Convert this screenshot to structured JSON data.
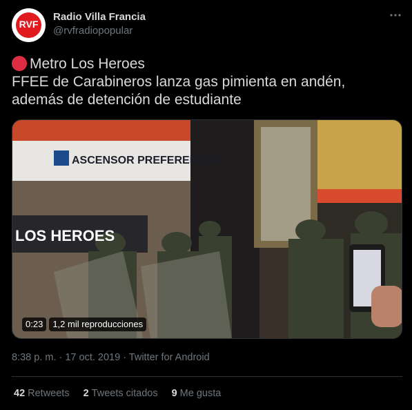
{
  "account": {
    "name": "Radio Villa Francia",
    "handle": "@rvfradiopopular",
    "avatar_text": "RVF",
    "more_icon": "ellipsis-icon"
  },
  "tweet": {
    "emoji": "red-circle",
    "line1": "Metro Los Heroes",
    "line2": "FFEE  de Carabineros  lanza  gas pimienta en andén,",
    "line3": "además de detención de estudiante"
  },
  "media": {
    "sign_main": "ASCENSOR PREFERENCIAL",
    "sign_station": "LOS HEROES",
    "duration": "0:23",
    "views": "1,2 mil reproducciones"
  },
  "meta": {
    "timestamp": "8:38 p. m. · 17 oct. 2019 · Twitter for Android"
  },
  "stats": {
    "retweets_count": "42",
    "retweets_label": "Retweets",
    "quotes_count": "2",
    "quotes_label": "Tweets citados",
    "likes_count": "9",
    "likes_label": "Me gusta"
  },
  "colors": {
    "background": "#000000",
    "text": "#d9d9d9",
    "muted": "#6e767d",
    "divider": "#2f3336",
    "emoji_red": "#dd2e44",
    "avatar_red": "#e01a1f"
  }
}
